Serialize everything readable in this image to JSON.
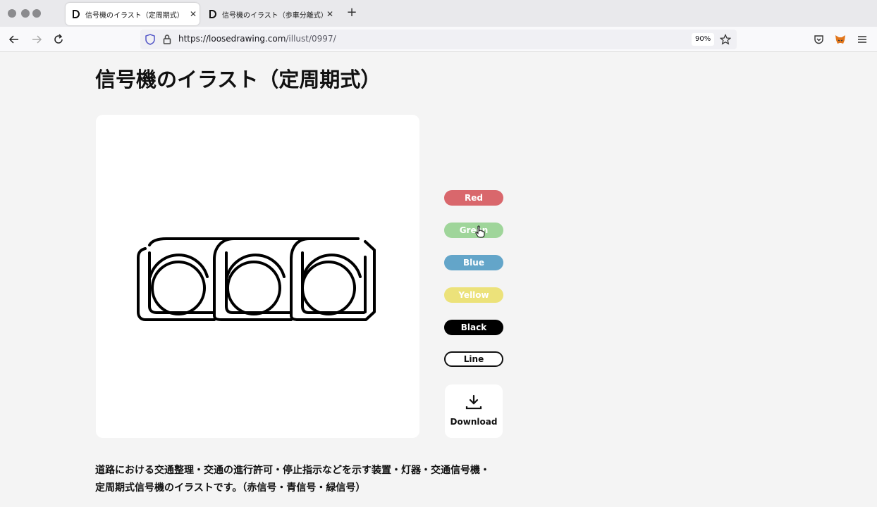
{
  "tabs": [
    {
      "title": "信号機のイラスト（定周期式） | L",
      "active": true
    },
    {
      "title": "信号機のイラスト（歩車分離式）",
      "active": false
    }
  ],
  "nav": {
    "url_host": "https://loosedrawing.com",
    "url_path": "/illust/0997/",
    "zoom": "90%"
  },
  "page": {
    "title": "信号機のイラスト（定周期式）",
    "color_buttons": [
      {
        "label": "Red",
        "bg": "#d9676c"
      },
      {
        "label": "Green",
        "bg": "#9fd59a"
      },
      {
        "label": "Blue",
        "bg": "#63a5c9"
      },
      {
        "label": "Yellow",
        "bg": "#ece27a"
      },
      {
        "label": "Black",
        "bg": "#000000"
      },
      {
        "label": "Line",
        "bg": "#ffffff"
      }
    ],
    "download_label": "Download",
    "description_line1": "道路における交通整理・交通の進行許可・停止指示などを示す装置・灯器・交通信号機・",
    "description_line2": "定周期式信号機のイラストです。（赤信号・青信号・緑信号）"
  }
}
